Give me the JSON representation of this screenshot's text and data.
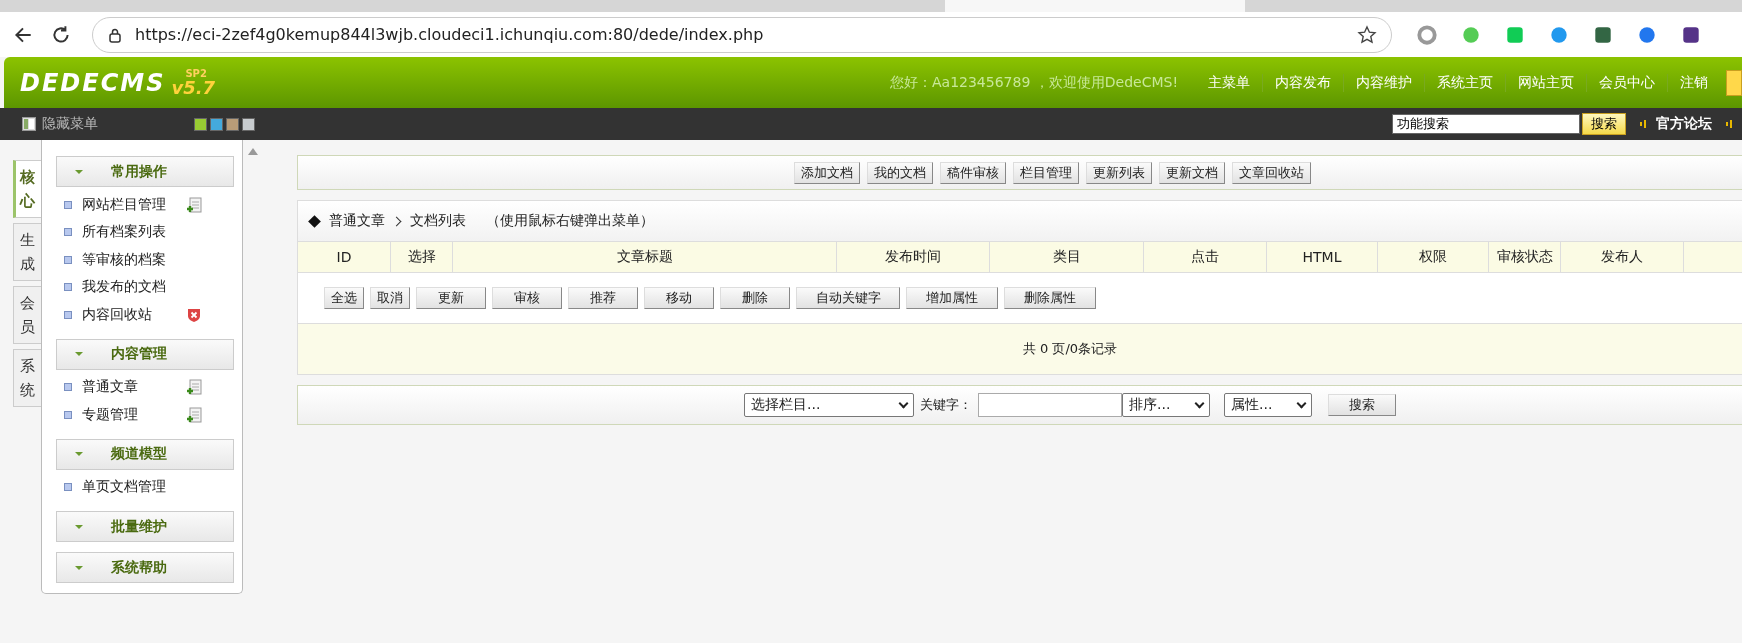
{
  "browser": {
    "url": "https://eci-2zef4g0kemup844l3wjb.cloudeci1.ichunqiu.com:80/dede/index.php"
  },
  "header": {
    "logo": "DEDECMS",
    "version": "v5.7",
    "edition": "SP2",
    "greeting": "您好：Aa123456789 ，欢迎使用DedeCMS!",
    "nav": [
      "主菜单",
      "内容发布",
      "内容维护",
      "系统主页",
      "网站主页",
      "会员中心",
      "注销"
    ]
  },
  "toolbar": {
    "hide_menu": "隐藏菜单",
    "skins": [
      {
        "color": "#99cc33"
      },
      {
        "color": "#44aadd"
      },
      {
        "color": "#b89c78"
      },
      {
        "color": "#c8cccf"
      }
    ],
    "search_value": "功能搜索",
    "search_button": "搜索",
    "forum_link": "官方论坛"
  },
  "side_tabs": [
    {
      "label": "核心",
      "selected": true
    },
    {
      "label": "生成",
      "selected": false
    },
    {
      "label": "会员",
      "selected": false
    },
    {
      "label": "系统",
      "selected": false
    }
  ],
  "menu_groups": [
    {
      "title": "常用操作",
      "items": [
        {
          "label": "网站栏目管理",
          "kind": "add"
        },
        {
          "label": "所有档案列表",
          "kind": "plain"
        },
        {
          "label": "等审核的档案",
          "kind": "plain"
        },
        {
          "label": "我发布的文档",
          "kind": "plain"
        },
        {
          "label": "内容回收站",
          "kind": "remove"
        }
      ]
    },
    {
      "title": "内容管理",
      "items": [
        {
          "label": "普通文章",
          "kind": "add"
        },
        {
          "label": "专题管理",
          "kind": "add"
        }
      ]
    },
    {
      "title": "频道模型",
      "items": [
        {
          "label": "单页文档管理",
          "kind": "plain"
        }
      ]
    },
    {
      "title": "批量维护"
    },
    {
      "title": "系统帮助"
    }
  ],
  "quick_buttons": [
    "添加文档",
    "我的文档",
    "稿件审核",
    "栏目管理",
    "更新列表",
    "更新文档",
    "文章回收站"
  ],
  "list": {
    "breadcrumb": [
      "普通文章",
      "文档列表"
    ],
    "hint": "（使用鼠标右键弹出菜单）",
    "columns": [
      "ID",
      "选择",
      "文章标题",
      "发布时间",
      "类目",
      "点击",
      "HTML",
      "权限",
      "审核状态",
      "发布人"
    ],
    "actions": [
      "全选",
      "取消",
      "更新",
      "审核",
      "推荐",
      "移动",
      "删除",
      "自动关键字",
      "增加属性",
      "删除属性"
    ],
    "pager": "共 0 页/0条记录"
  },
  "filter": {
    "category_select": "选择栏目...",
    "keyword_label": "关键字：",
    "sort_select": "排序...",
    "attribute_select": "属性...",
    "search_button": "搜索"
  }
}
